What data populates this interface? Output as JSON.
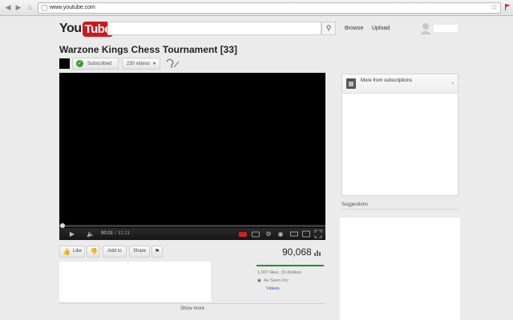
{
  "browser": {
    "url": "www.youtube.com"
  },
  "header": {
    "logo_you": "You",
    "logo_tube": "Tube",
    "search_placeholder": "",
    "browse_label": "Browse",
    "upload_label": "Upload"
  },
  "video": {
    "title": "Warzone Kings Chess Tournament [33]",
    "subscribed_label": "Subscribed",
    "videos_count_label": "230 videos",
    "current_time": "00:01",
    "time_separator": "/",
    "duration": "31:21",
    "progress_fraction": 0.003
  },
  "actions": {
    "like_label": "Like",
    "add_to_label": "Add to",
    "share_label": "Share",
    "view_count": "90,068",
    "likes_text": "1,007 likes, 15 dislikes",
    "seen_text": "As Seen On:",
    "videos_link": "Videos",
    "show_more_label": "Show more"
  },
  "sidebar": {
    "subs_title": "More from subscriptions",
    "suggestions_title": "Suggestions"
  },
  "colors": {
    "brand_red": "#cc181e",
    "like_green": "#2d8a2d",
    "link_blue": "#1f5fbf"
  }
}
